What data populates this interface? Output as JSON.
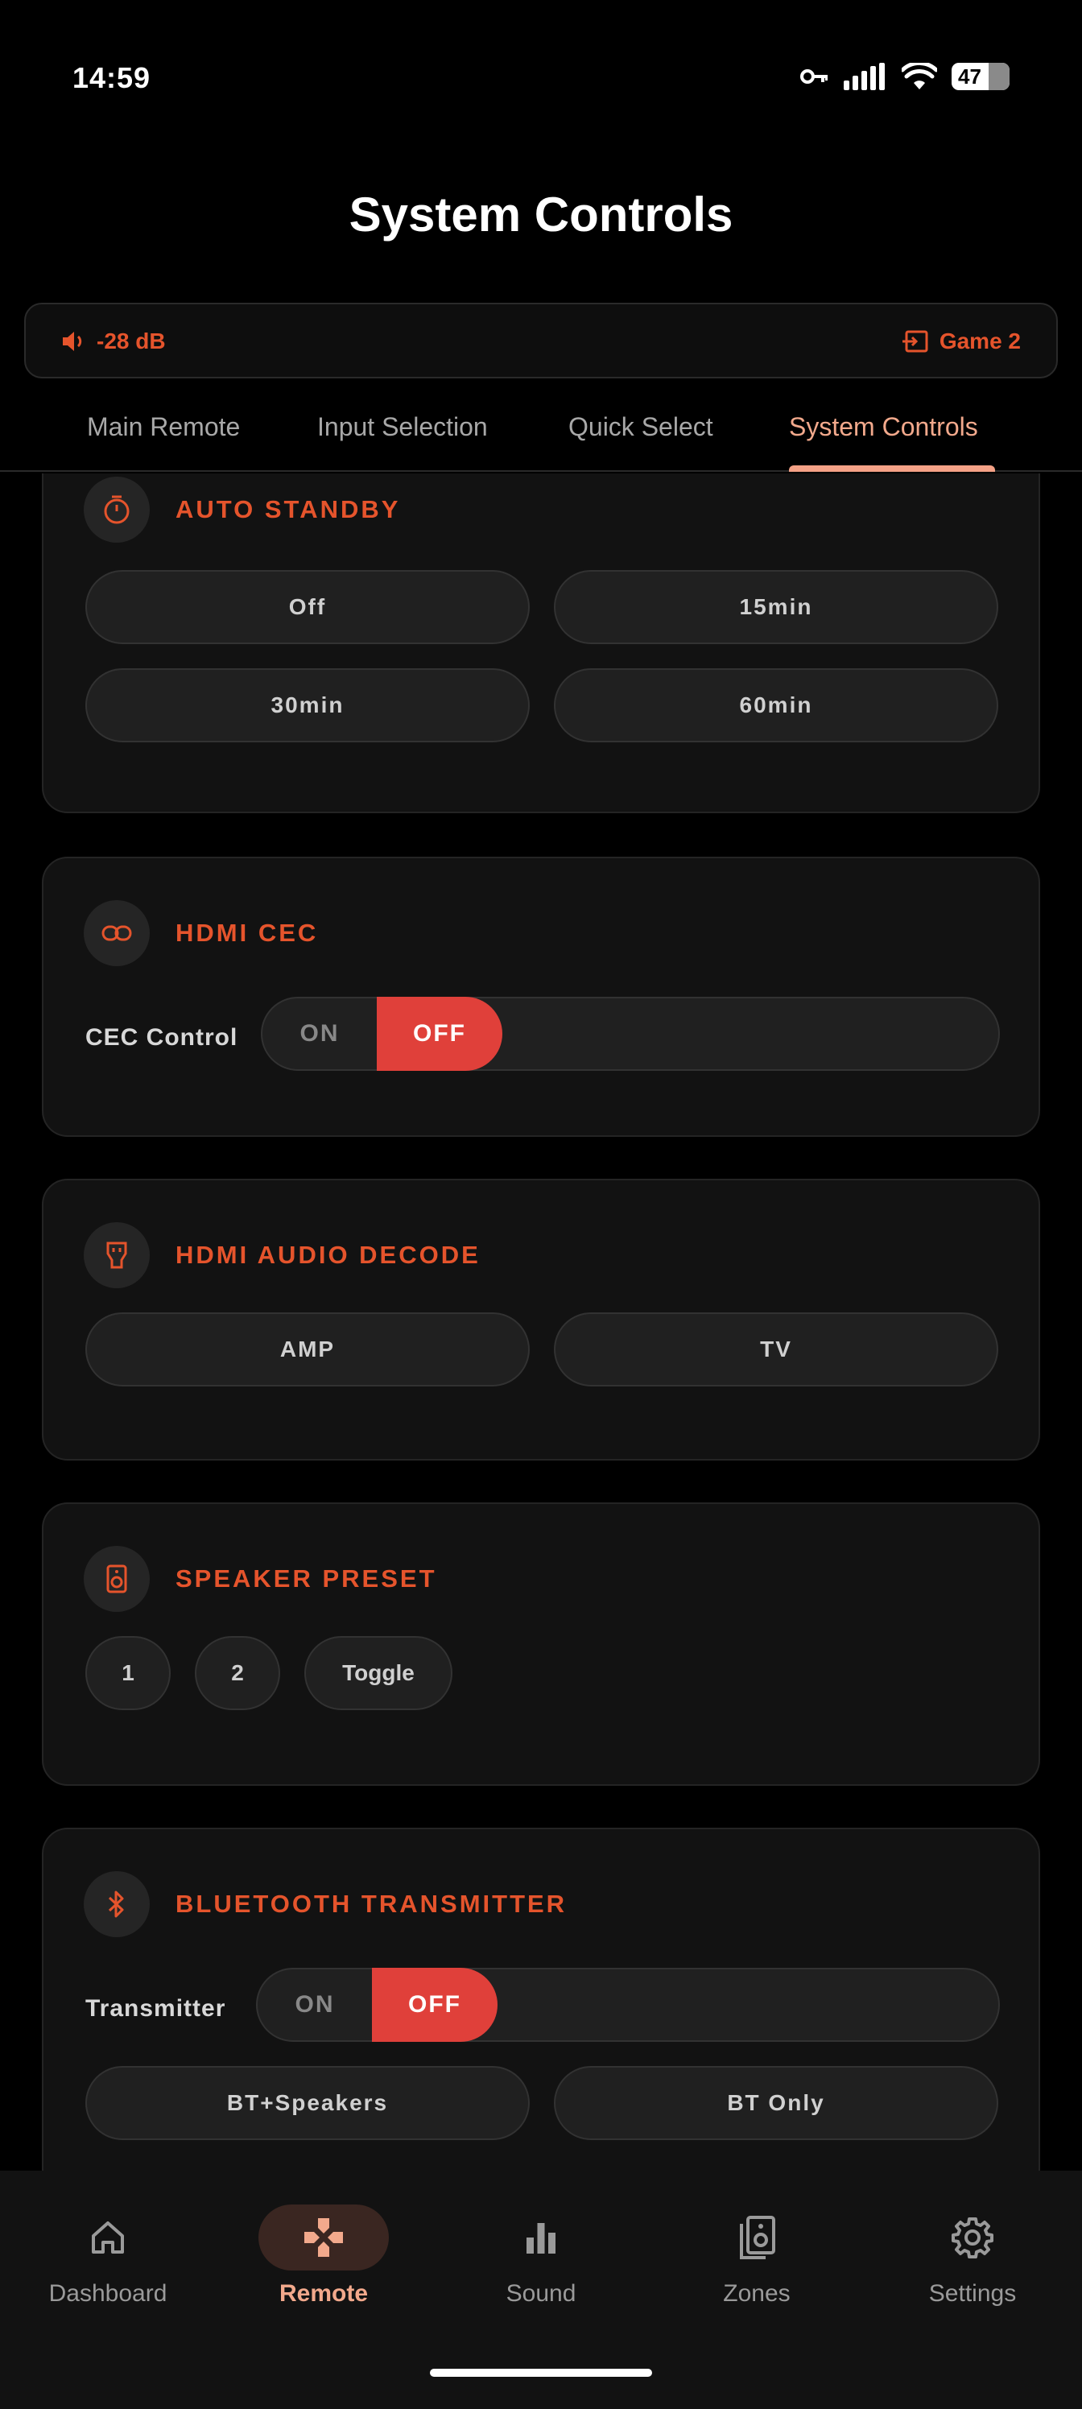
{
  "status": {
    "time": "14:59",
    "battery": "47"
  },
  "header": {
    "title": "System Controls"
  },
  "info_strip": {
    "volume": "-28 dB",
    "input": "Game 2"
  },
  "tabs": [
    {
      "label": "Main Remote"
    },
    {
      "label": "Input Selection"
    },
    {
      "label": "Quick Select"
    },
    {
      "label": "System Controls"
    }
  ],
  "active_tab": "System Controls",
  "cards": {
    "auto_standby": {
      "title": "AUTO STANDBY",
      "options": [
        "Off",
        "15min",
        "30min",
        "60min"
      ]
    },
    "hdmi_cec": {
      "title": "HDMI CEC",
      "row_label": "CEC Control",
      "on_label": "ON",
      "off_label": "OFF",
      "state": "OFF"
    },
    "hdmi_audio_decode": {
      "title": "HDMI AUDIO DECODE",
      "options": [
        "AMP",
        "TV"
      ]
    },
    "speaker_preset": {
      "title": "SPEAKER PRESET",
      "options": [
        "1",
        "2",
        "Toggle"
      ]
    },
    "bluetooth_transmitter": {
      "title": "BLUETOOTH TRANSMITTER",
      "row_label": "Transmitter",
      "on_label": "ON",
      "off_label": "OFF",
      "state": "OFF",
      "options": [
        "BT+Speakers",
        "BT Only"
      ]
    }
  },
  "bottom_nav": {
    "items": [
      {
        "label": "Dashboard",
        "icon": "home-icon"
      },
      {
        "label": "Remote",
        "icon": "gamepad-icon"
      },
      {
        "label": "Sound",
        "icon": "bar-chart-icon"
      },
      {
        "label": "Zones",
        "icon": "speakers-icon"
      },
      {
        "label": "Settings",
        "icon": "gear-icon"
      }
    ],
    "active": "Remote"
  },
  "colors": {
    "accent": "#e5542c",
    "active_tab": "#f2a98c",
    "toggle_off": "#e0403a",
    "background": "#000000",
    "card": "#121212"
  }
}
